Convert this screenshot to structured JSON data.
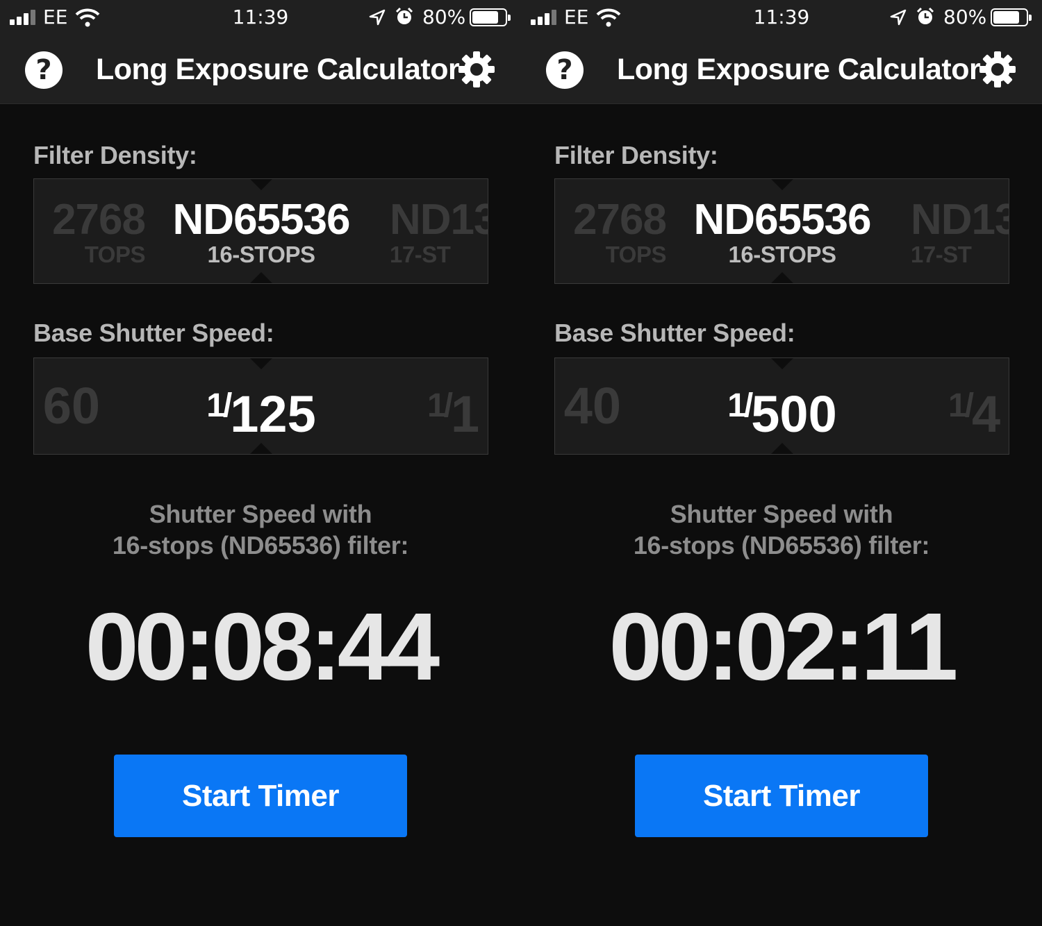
{
  "colors": {
    "bar_background": "#202020",
    "screen_background": "#0d0d0d",
    "accent_button": "#0a77f5",
    "label_text": "#b7b7b7"
  },
  "screens": [
    {
      "status": {
        "carrier": "EE",
        "time": "11:39",
        "battery_pct": "80%",
        "battery_level": 0.8,
        "signal_bars_active": 3
      },
      "header": {
        "title": "Long Exposure Calculator",
        "help_icon": "?",
        "settings_icon": "gear-icon"
      },
      "filter_density": {
        "label": "Filter Density:",
        "prev": {
          "value": "2768",
          "stops": "TOPS"
        },
        "selected": {
          "value": "ND65536",
          "stops": "16-STOPS"
        },
        "next": {
          "value": "ND13",
          "stops": "17-ST"
        }
      },
      "base_shutter": {
        "label": "Base Shutter Speed:",
        "prev": {
          "value": "60"
        },
        "selected": {
          "fraction": "1/",
          "value": "125"
        },
        "next": {
          "fraction": "1/",
          "value": "1"
        }
      },
      "result": {
        "label_line1": "Shutter Speed with",
        "label_line2": "16-stops (ND65536) filter:",
        "time": "00:08:44"
      },
      "button": {
        "label": "Start Timer"
      }
    },
    {
      "status": {
        "carrier": "EE",
        "time": "11:39",
        "battery_pct": "80%",
        "battery_level": 0.8,
        "signal_bars_active": 3
      },
      "header": {
        "title": "Long Exposure Calculator",
        "help_icon": "?",
        "settings_icon": "gear-icon"
      },
      "filter_density": {
        "label": "Filter Density:",
        "prev": {
          "value": "2768",
          "stops": "TOPS"
        },
        "selected": {
          "value": "ND65536",
          "stops": "16-STOPS"
        },
        "next": {
          "value": "ND13",
          "stops": "17-ST"
        }
      },
      "base_shutter": {
        "label": "Base Shutter Speed:",
        "prev": {
          "value": "40"
        },
        "selected": {
          "fraction": "1/",
          "value": "500"
        },
        "next": {
          "fraction": "1/",
          "value": "4"
        }
      },
      "result": {
        "label_line1": "Shutter Speed with",
        "label_line2": "16-stops (ND65536) filter:",
        "time": "00:02:11"
      },
      "button": {
        "label": "Start Timer"
      }
    }
  ]
}
